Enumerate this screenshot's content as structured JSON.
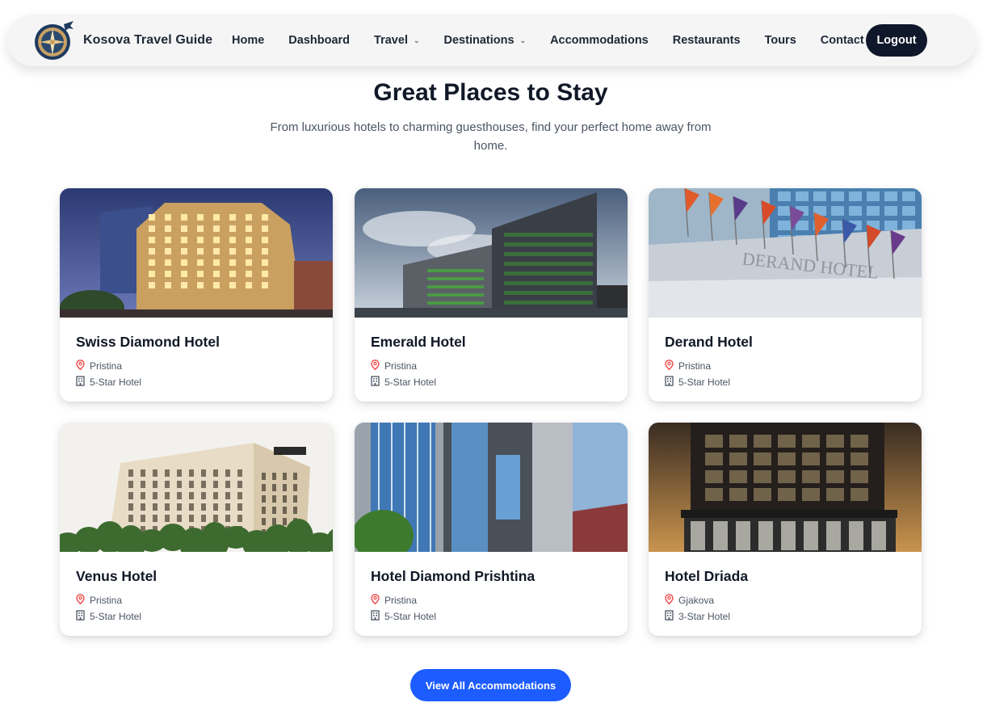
{
  "header": {
    "brand": "Kosova Travel Guide",
    "nav": [
      {
        "label": "Home",
        "dropdown": false
      },
      {
        "label": "Dashboard",
        "dropdown": false
      },
      {
        "label": "Travel",
        "dropdown": true
      },
      {
        "label": "Destinations",
        "dropdown": true
      },
      {
        "label": "Accommodations",
        "dropdown": false
      },
      {
        "label": "Restaurants",
        "dropdown": false
      },
      {
        "label": "Tours",
        "dropdown": false
      },
      {
        "label": "Contact",
        "dropdown": false
      }
    ],
    "logout_label": "Logout"
  },
  "section": {
    "title": "Great Places to Stay",
    "subtitle": "From luxurious hotels to charming guesthouses, find your perfect home away from home."
  },
  "hotels": [
    {
      "name": "Swiss Diamond Hotel",
      "city": "Pristina",
      "category": "5-Star Hotel",
      "image": "night-hotel-building-photo"
    },
    {
      "name": "Emerald Hotel",
      "city": "Pristina",
      "category": "5-Star Hotel",
      "image": "modern-green-facade-hotel-photo"
    },
    {
      "name": "Derand Hotel",
      "city": "Pristina",
      "category": "5-Star Hotel",
      "image": "hotel-entrance-with-flags-photo"
    },
    {
      "name": "Venus Hotel",
      "city": "Pristina",
      "category": "5-Star Hotel",
      "image": "classic-cream-hotel-photo"
    },
    {
      "name": "Hotel Diamond Prishtina",
      "city": "Pristina",
      "category": "5-Star Hotel",
      "image": "glass-tower-hotel-photo"
    },
    {
      "name": "Hotel Driada",
      "city": "Gjakova",
      "category": "3-Star Hotel",
      "image": "dark-lattice-facade-hotel-photo"
    }
  ],
  "image_signs": {
    "derand": "DERAND HOTEL"
  },
  "icons": {
    "location": "map-pin-icon",
    "category": "building-icon",
    "dropdown": "chevron-down-icon"
  },
  "colors": {
    "accent": "#1d5cff",
    "dark": "#0f172a",
    "pin": "#ef4444",
    "nav_bg": "#f5f5f5"
  },
  "view_all_label": "View All Accommodations"
}
